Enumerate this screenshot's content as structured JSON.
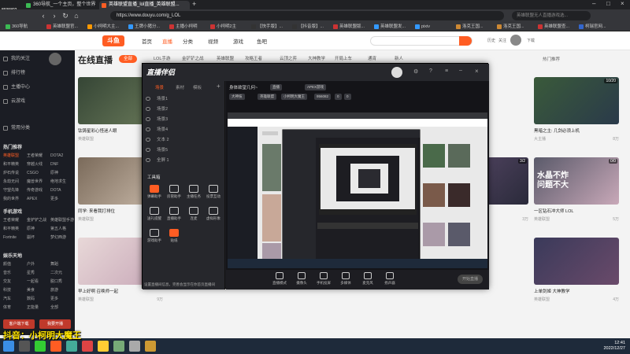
{
  "browser": {
    "tabs": [
      {
        "label": "360导航_一个主页，整个世界",
        "active": false
      },
      {
        "label": "英雄联盟直播_lol直播_英雄联盟...",
        "active": true
      }
    ],
    "url": "https://www.douyu.com/g_LOL",
    "search_placeholder": "英雄联盟无人直播游戏选...",
    "bookmarks": [
      "360导航",
      "英雄联盟官...",
      "小柯明大主...",
      "王牌小猪分...",
      "主播小柯明",
      "小柯明2主",
      "【快手版】...",
      "【抖音版】...",
      "英雄联盟版...",
      "英雄联盟发...",
      "pixiv",
      "洛克王国...",
      "洛克王国...",
      "英雄联盟查...",
      "柯瑞官网..."
    ],
    "counter": "8935802"
  },
  "site": {
    "logo": "斗鱼",
    "nav": [
      "首页",
      "直播",
      "分类",
      "视频",
      "游戏",
      "鱼吧"
    ],
    "active_nav": "直播",
    "header_icons": [
      "历史",
      "关注",
      "下载",
      "消息",
      "充值"
    ]
  },
  "sidebar": {
    "items": [
      "我的关注",
      "排行榜",
      "主播中心",
      "云游戏",
      "常用分类"
    ],
    "section_hot": "热门推荐",
    "categories": [
      [
        "英雄联盟",
        "王者荣耀",
        "DOTA2"
      ],
      [
        "和平精英",
        "穿越火线",
        "DNF"
      ],
      [
        "炉石传说",
        "CSGO",
        "原神"
      ],
      [
        "永劫无间",
        "魔兽世界",
        "绝地求生"
      ],
      [
        "守望先锋",
        "传奇游戏",
        "DOTA"
      ],
      [
        "我的世界",
        "APEX",
        "更多"
      ]
    ],
    "section_mobile": "手机游戏",
    "categories2": [
      [
        "王者荣耀",
        "金铲铲之战",
        "英雄联盟手游"
      ],
      [
        "和平精英",
        "原神",
        "第五人格"
      ],
      [
        "Fortnite",
        "崩坏",
        "梦幻西游"
      ]
    ],
    "section_ent": "娱乐天地",
    "categories3": [
      [
        "颜值",
        "户外",
        "舞蹈"
      ],
      [
        "音乐",
        "星秀",
        "二次元"
      ],
      [
        "交友",
        "一起看",
        "脱口秀"
      ],
      [
        "科技",
        "美食",
        "旅游"
      ],
      [
        "汽车",
        "数码",
        "更多"
      ],
      [
        "体育",
        "正能量",
        "全部"
      ]
    ],
    "bottom_buttons": [
      "客户端下载",
      "我要开播"
    ]
  },
  "main": {
    "title": "在线直播",
    "category_tabs": [
      "全部",
      "LOL手游",
      "金铲铲之战",
      "英雄联盟",
      "攻略王者",
      "云顶之弈",
      "大神教学",
      "开局上车",
      "通宵",
      "新人"
    ],
    "active_tab": "全部",
    "right_link": "热门推荐",
    "cards": [
      {
        "title": "钛铸星彩心怪迷人眼",
        "sub": "英雄联盟",
        "heat": "10万"
      },
      {
        "title": "黑暗之主: 几剑必须上机",
        "sub": "大主播",
        "heat": "8万"
      },
      {
        "title": "雾都游荡者 加油冲分",
        "sub": "英雄联盟",
        "heat": "3万"
      },
      {
        "title": "同学: 来看我打排位",
        "sub": "英雄联盟",
        "heat": "12万"
      },
      {
        "title": "一区钻石冲大师 LOL",
        "sub": "英雄联盟",
        "heat": "5万"
      },
      {
        "title": "早上好啊 召唤师一起",
        "sub": "英雄联盟",
        "heat": "9万"
      },
      {
        "title": "上单剑姬 大神教学",
        "sub": "英雄联盟",
        "heat": "4万"
      }
    ],
    "card_badges": [
      "0/00",
      "10/20",
      "3/2",
      "10/3",
      "0/0",
      "20"
    ],
    "overlay_text": [
      "水晶不炸",
      "问题不大"
    ]
  },
  "app": {
    "name": "直播伴侣",
    "left_tabs": [
      "场景",
      "素材",
      "模板"
    ],
    "active_left_tab": "场景",
    "scenes": [
      "场景1",
      "场景2",
      "场景3",
      "场景4",
      "文本 2",
      "场景5",
      "全屏 1"
    ],
    "tools_label": "工具箱",
    "tools": [
      "弹幕助手",
      "房管助手",
      "主播任务",
      "投票互动",
      "送礼提醒",
      "直播助手",
      "连麦",
      "虚拟形象",
      "游戏助手",
      "贴纸"
    ],
    "hot_tools": [
      0,
      9
    ],
    "stream_title": "身体欲望几何~",
    "pills": [
      "直播",
      "APEX游戏",
      "大神技",
      "英雄联盟",
      "小柯明大魔王",
      "956082",
      "0",
      "0"
    ],
    "bottom_tools": [
      "直播模式",
      "摄像头",
      "手机投屏",
      "多媒体",
      "麦克风",
      "扬声器"
    ],
    "go_live": "开始直播",
    "notice": "设置直播间信息，完善会显示在你首页直播间"
  },
  "taskbar": {
    "time": "12:41",
    "date": "2022/12/27"
  },
  "watermark": "抖音：小柯明大魔王"
}
